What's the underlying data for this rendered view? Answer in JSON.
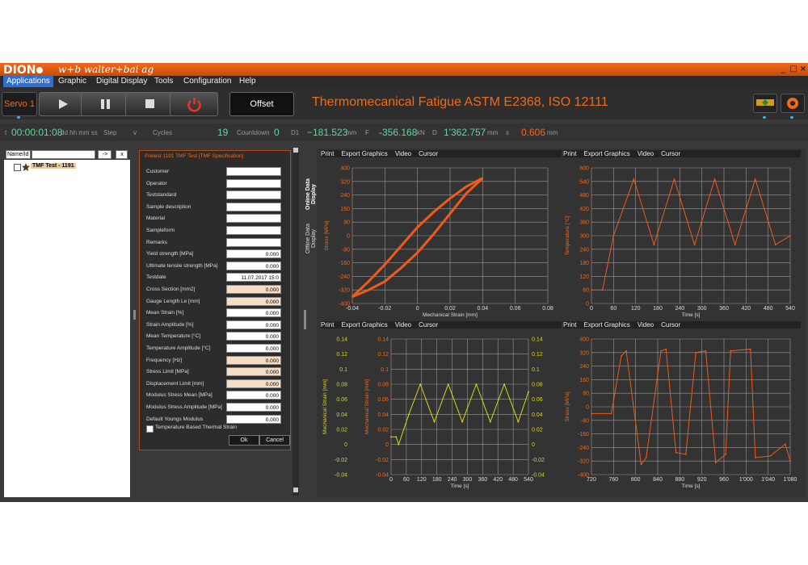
{
  "app": {
    "logo": "DION",
    "company": "w+b  walter+bai ag",
    "window_controls": [
      "_",
      "□",
      "×"
    ]
  },
  "menu": [
    "Applications",
    "Graphic",
    "Digital Display",
    "Tools",
    "Configuration",
    "Help"
  ],
  "toolbar": {
    "servo_label": "Servo 1",
    "offset_label": "Offset",
    "test_title": "Thermomecanical Fatigue ASTM E2368, ISO 12111"
  },
  "status": {
    "t_label": "t",
    "time": "00:00:01:08",
    "time_format": "dd hh mm ss",
    "step_label": "Step",
    "v_label": "v",
    "cycles_label": "Cycles",
    "cycles": "19",
    "countdown_label": "Countdown",
    "countdown": "0",
    "d1_label": "D1",
    "d1": "−181.523",
    "d1_unit": "mm",
    "f_label": "F",
    "f": "-356.168",
    "f_unit": "kN",
    "d_label": "D",
    "d": "1'362.757",
    "d_unit": "mm",
    "s_label": "s",
    "s": "0.606",
    "s_unit": "mm"
  },
  "sidebar": {
    "filter_label": "Name/Id",
    "go_button": "->",
    "clear_button": "x",
    "tree_item": "TMF Test - 1191"
  },
  "vertical_tabs": [
    "Online Data Display",
    "Offline Data Display"
  ],
  "form": {
    "title": "Pretest 1191 TMF Test [TMF Specification]",
    "rows": [
      {
        "label": "Customer",
        "value": "",
        "highlight": false
      },
      {
        "label": "Operator",
        "value": "",
        "highlight": false
      },
      {
        "label": "Teststandard",
        "value": "",
        "highlight": false
      },
      {
        "label": "Sample description",
        "value": "",
        "highlight": false
      },
      {
        "label": "Material",
        "value": "",
        "highlight": false
      },
      {
        "label": "Sampleform",
        "value": "",
        "highlight": false
      },
      {
        "label": "Remarks",
        "value": "",
        "highlight": false
      },
      {
        "label": "Yield strength [MPa]",
        "value": "0.000",
        "highlight": false
      },
      {
        "label": "Ultimate tensile strength [MPa]",
        "value": "0.000",
        "highlight": false
      },
      {
        "label": "Testdate",
        "value": "11.07.2017 15:0",
        "highlight": false
      },
      {
        "label": "Cross Section [mm2]",
        "value": "0.000",
        "highlight": true
      },
      {
        "label": "Gauge Length Le [mm]",
        "value": "0.000",
        "highlight": true
      },
      {
        "label": "Mean Strain [%]",
        "value": "0.000",
        "highlight": false
      },
      {
        "label": "Strain Amplitude [%]",
        "value": "0.000",
        "highlight": false
      },
      {
        "label": "Mean Temperature [°C]",
        "value": "0.000",
        "highlight": false
      },
      {
        "label": "Temperature Amplitude [°C]",
        "value": "0.000",
        "highlight": false
      },
      {
        "label": "Frequency [Hz]",
        "value": "0.000",
        "highlight": true
      },
      {
        "label": "Stress Limit [MPa]",
        "value": "0.000",
        "highlight": true
      },
      {
        "label": "Displacement Limit [mm]",
        "value": "0.000",
        "highlight": true
      },
      {
        "label": "Modulus Stress Mean [MPa]",
        "value": "0.000",
        "highlight": false
      },
      {
        "label": "Modulus Stress Amplitude [MPa]",
        "value": "0.000",
        "highlight": false
      },
      {
        "label": "Default Youngs Modulus",
        "value": "0.000",
        "highlight": false
      }
    ],
    "checkbox_label": "Temperature Based Thermal Strain",
    "ok": "Ok",
    "cancel": "Cancel"
  },
  "chart_menu": [
    "Print",
    "Export Graphics",
    "Video",
    "Cursor"
  ],
  "colors": {
    "accent": "#f06a1a",
    "trace_orange": "#f05a1a",
    "trace_yellow": "#d6d61a",
    "grid": "#9a9a9a",
    "green": "#5fd7a0"
  },
  "chart_data": [
    {
      "type": "scatter",
      "xlabel": "Mechanical Strain [mm]",
      "ylabel": "Stress [MPa]",
      "xlim": [
        -0.04,
        0.08
      ],
      "ylim": [
        -400,
        400
      ],
      "xticks": [
        "-0.04",
        "-0.02",
        "0",
        "0.02",
        "0.04",
        "0.06",
        "0.08"
      ],
      "yticks": [
        "400",
        "320",
        "240",
        "160",
        "80",
        "0",
        "-80",
        "-160",
        "-240",
        "-320",
        "-400"
      ],
      "x": [
        -0.04,
        -0.03,
        -0.02,
        -0.01,
        0,
        0.01,
        0.02,
        0.03,
        0.04,
        0.03,
        0.02,
        0.01,
        0,
        -0.01,
        -0.02,
        -0.03,
        -0.04
      ],
      "y": [
        -360,
        -270,
        -170,
        -60,
        50,
        140,
        220,
        290,
        340,
        250,
        130,
        10,
        -100,
        -190,
        -270,
        -320,
        -360
      ]
    },
    {
      "type": "line",
      "xlabel": "Time [s]",
      "ylabel": "Temperature [°C]",
      "xlim": [
        0,
        540
      ],
      "ylim": [
        0,
        600
      ],
      "xticks": [
        "0",
        "60",
        "120",
        "180",
        "240",
        "300",
        "360",
        "420",
        "480",
        "540"
      ],
      "yticks": [
        "600",
        "540",
        "480",
        "420",
        "360",
        "300",
        "240",
        "180",
        "120",
        "60",
        "0"
      ],
      "x": [
        0,
        30,
        60,
        115,
        170,
        225,
        280,
        335,
        390,
        445,
        500,
        540
      ],
      "y": [
        60,
        60,
        300,
        550,
        260,
        550,
        260,
        550,
        260,
        550,
        260,
        300
      ]
    },
    {
      "type": "line",
      "xlabel": "Time [s]",
      "ylabel": "Mechanical Strain [mm]",
      "xlim": [
        0,
        540
      ],
      "ylim": [
        -0.04,
        0.14
      ],
      "xticks": [
        "0",
        "60",
        "120",
        "180",
        "240",
        "300",
        "360",
        "420",
        "480",
        "540"
      ],
      "yticks": [
        "0.14",
        "0.12",
        "0.1",
        "0.08",
        "0.06",
        "0.04",
        "0.02",
        "0",
        "-0.02",
        "-0.04"
      ],
      "x": [
        0,
        20,
        30,
        70,
        115,
        170,
        225,
        280,
        335,
        390,
        445,
        500,
        540
      ],
      "y": [
        0.01,
        0.01,
        0,
        0.04,
        0.08,
        0.03,
        0.08,
        0.03,
        0.08,
        0.03,
        0.08,
        0.03,
        0.07
      ]
    },
    {
      "type": "line",
      "xlabel": "Time [s]",
      "ylabel": "Stress [MPa]",
      "xlim": [
        700,
        1100
      ],
      "ylim": [
        -400,
        400
      ],
      "xticks": [
        "720",
        "760",
        "800",
        "840",
        "880",
        "920",
        "960",
        "1'000",
        "1'040",
        "1'080"
      ],
      "yticks": [
        "400",
        "320",
        "240",
        "160",
        "80",
        "0",
        "-80",
        "-160",
        "-240",
        "-320",
        "-400"
      ],
      "x": [
        700,
        740,
        760,
        770,
        800,
        810,
        840,
        850,
        870,
        890,
        910,
        930,
        950,
        970,
        980,
        1020,
        1030,
        1060,
        1090,
        1100
      ],
      "y": [
        -40,
        -40,
        300,
        330,
        -340,
        -300,
        330,
        340,
        -270,
        -280,
        320,
        330,
        -330,
        -280,
        330,
        340,
        -300,
        -290,
        -220,
        -320
      ]
    }
  ]
}
